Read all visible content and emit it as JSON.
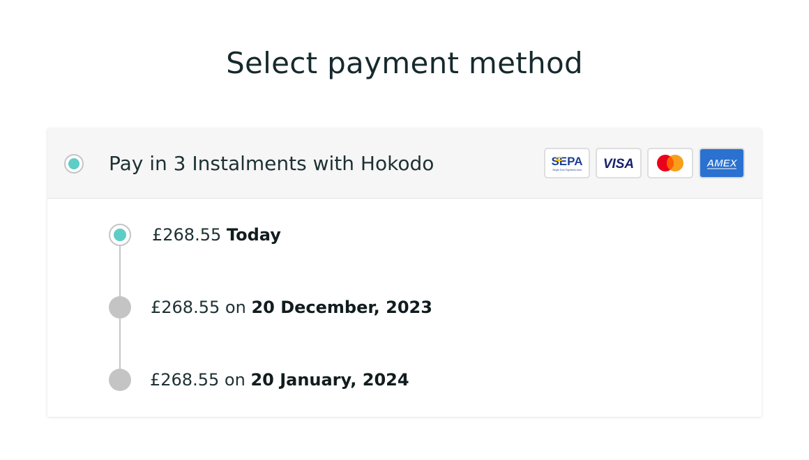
{
  "page": {
    "title": "Select payment method"
  },
  "payment_option": {
    "label": "Pay in 3 Instalments with Hokodo",
    "selected": true,
    "accent_color": "#5ecdc5"
  },
  "card_logos": [
    {
      "name": "SEPA",
      "text": "SEPA",
      "subtext": "Single Euro Payments Area"
    },
    {
      "name": "VISA",
      "text": "VISA"
    },
    {
      "name": "Mastercard",
      "text": ""
    },
    {
      "name": "AMEX",
      "text": "AMEX"
    }
  ],
  "instalments": [
    {
      "amount": "£268.55",
      "connector": "",
      "when": "Today",
      "status": "current"
    },
    {
      "amount": "£268.55",
      "connector": "on",
      "when": "20 December, 2023",
      "status": "pending"
    },
    {
      "amount": "£268.55",
      "connector": "on",
      "when": "20 January, 2024",
      "status": "pending"
    }
  ]
}
